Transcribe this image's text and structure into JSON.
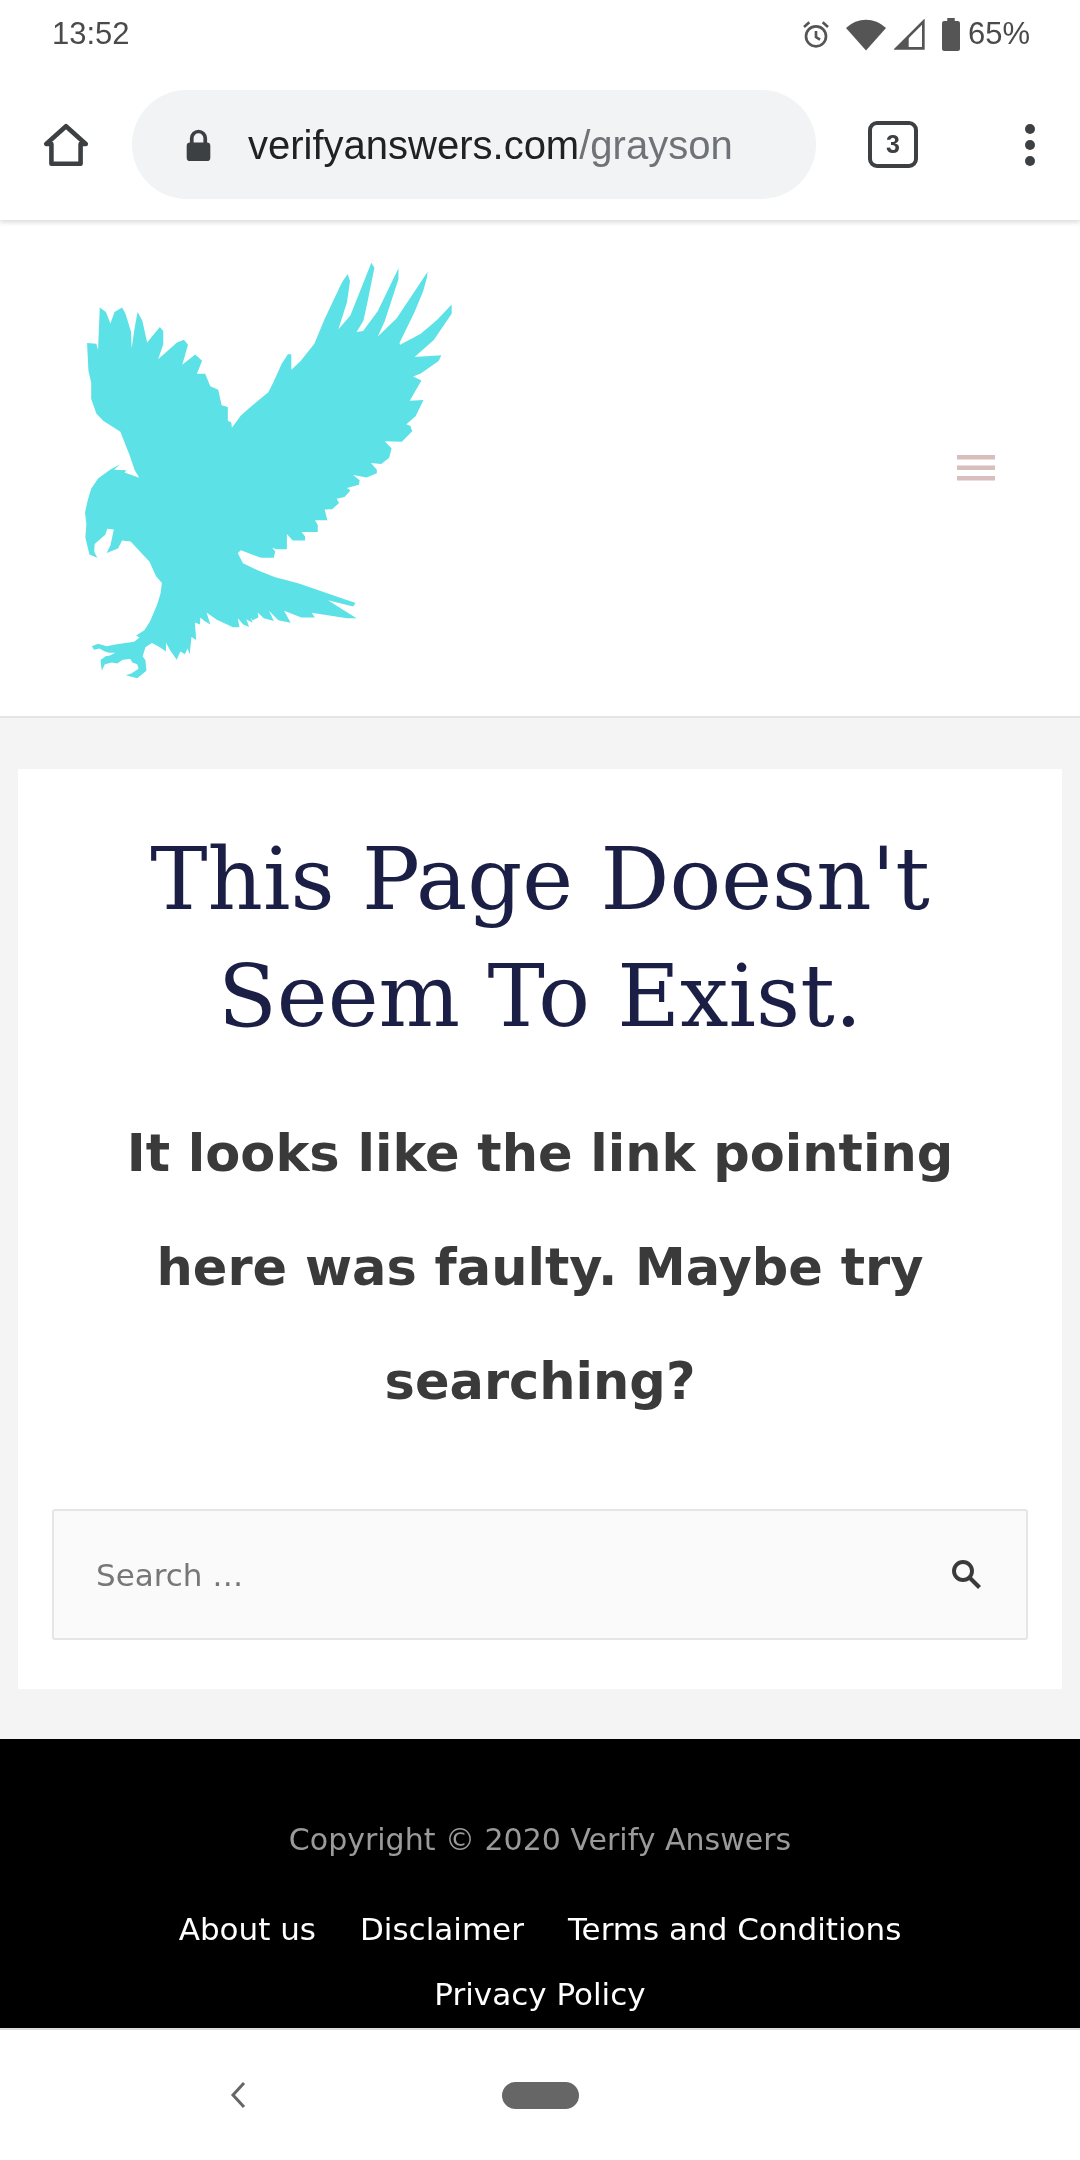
{
  "status_bar": {
    "time": "13:52",
    "battery": "65%"
  },
  "browser_toolbar": {
    "url_domain": "verifyanswers.com",
    "url_path": "/grayson",
    "tab_count": "3"
  },
  "error_page": {
    "title": "This Page Doesn't Seem To Exist.",
    "message": "It looks like the link pointing here was faulty. Maybe try searching?",
    "search": {
      "placeholder": "Search …"
    }
  },
  "footer": {
    "copyright": "Copyright © 2020 Verify Answers",
    "links": [
      "About us",
      "Disclaimer",
      "Terms and Conditions",
      "Privacy Policy"
    ]
  }
}
